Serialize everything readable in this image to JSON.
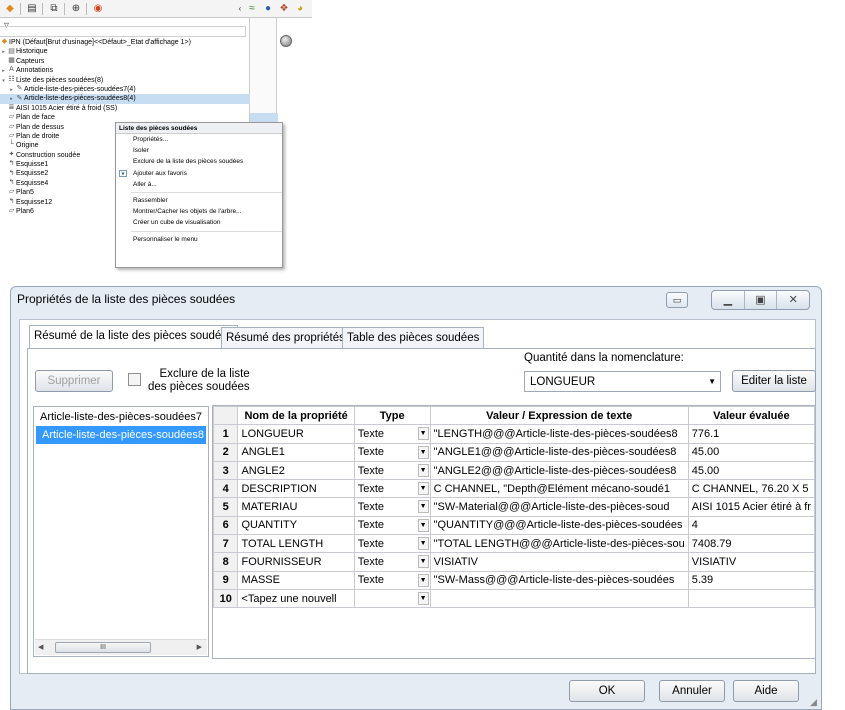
{
  "tree": {
    "root_label": "IPN  (Défaut[Brut d'usinage]<<Défaut>_Etat d'affichage 1>)",
    "items": [
      {
        "label": "Historique",
        "icon": "history-icon",
        "arrow": "▸"
      },
      {
        "label": "Capteurs",
        "icon": "sensor-icon",
        "arrow": ""
      },
      {
        "label": "Annotations",
        "icon": "annotations-icon",
        "arrow": "▸"
      },
      {
        "label": "Liste des pièces soudées(8)",
        "icon": "cutlist-icon",
        "arrow": "▾"
      },
      {
        "label": "Article-liste-des-pièces-soudées7(4)",
        "icon": "cutlist-item-icon",
        "arrow": "▸",
        "indent": 1
      },
      {
        "label": "Article-liste-des-pièces-soudées8(4)",
        "icon": "cutlist-item-icon",
        "arrow": "▸",
        "indent": 1,
        "selected": true
      },
      {
        "label": "AISI 1015 Acier étiré à froid (SS)",
        "icon": "material-icon",
        "arrow": ""
      },
      {
        "label": "Plan de face",
        "icon": "plane-icon",
        "arrow": ""
      },
      {
        "label": "Plan de dessus",
        "icon": "plane-icon",
        "arrow": ""
      },
      {
        "label": "Plan de droite",
        "icon": "plane-icon",
        "arrow": ""
      },
      {
        "label": "Origine",
        "icon": "origin-icon",
        "arrow": ""
      },
      {
        "label": "Construction soudée",
        "icon": "weldment-icon",
        "arrow": ""
      },
      {
        "label": "Esquisse1",
        "icon": "sketch-icon",
        "arrow": ""
      },
      {
        "label": "Esquisse2",
        "icon": "sketch-icon",
        "arrow": ""
      },
      {
        "label": "Esquisse4",
        "icon": "sketch-icon",
        "arrow": ""
      },
      {
        "label": "Plan5",
        "icon": "plane-icon",
        "arrow": ""
      },
      {
        "label": "Esquisse12",
        "icon": "sketch-icon",
        "arrow": ""
      },
      {
        "label": "Plan6",
        "icon": "plane-icon",
        "arrow": ""
      }
    ]
  },
  "context_menu": {
    "header": "Liste des pièces soudées",
    "items": [
      "Propriétés...",
      "Isoler",
      "Exclure de la liste des pièces soudées",
      "Ajouter aux favoris",
      "Aller à...",
      "Rassembler",
      "Montrer/Cacher les objets de l'arbre...",
      "Créer un cube de visualisation",
      "Personnaliser le menu"
    ]
  },
  "dialog": {
    "title": "Propriétés de la liste des pièces soudées",
    "tabs": [
      "Résumé de la liste des pièces soudées",
      "Résumé des propriétés",
      "Table des pièces soudées"
    ],
    "delete_button": "Supprimer",
    "exclude_label_1": "Exclure de la liste",
    "exclude_label_2": "des pièces soudées",
    "quantity_label": "Quantité dans la nomenclature:",
    "quantity_value": "LONGUEUR",
    "edit_list_button": "Editer la liste",
    "cutlist_items": [
      "Article-liste-des-pièces-soudées7",
      "Article-liste-des-pièces-soudées8"
    ],
    "scroll_thumb": "III",
    "columns": [
      "Nom de la propriété",
      "Type",
      "Valeur / Expression de texte",
      "Valeur évaluée"
    ],
    "rows": [
      {
        "n": "1",
        "name": "LONGUEUR",
        "type": "Texte",
        "expr": "\"LENGTH@@@Article-liste-des-pièces-soudées8",
        "value": "776.1"
      },
      {
        "n": "2",
        "name": "ANGLE1",
        "type": "Texte",
        "expr": "\"ANGLE1@@@Article-liste-des-pièces-soudées8",
        "value": "45.00"
      },
      {
        "n": "3",
        "name": "ANGLE2",
        "type": "Texte",
        "expr": "\"ANGLE2@@@Article-liste-des-pièces-soudées8",
        "value": "45.00"
      },
      {
        "n": "4",
        "name": "DESCRIPTION",
        "type": "Texte",
        "expr": "C CHANNEL, \"Depth@Elément mécano-soudé1",
        "value": "C CHANNEL, 76.20 X 5"
      },
      {
        "n": "5",
        "name": "MATERIAU",
        "type": "Texte",
        "expr": "\"SW-Material@@@Article-liste-des-pièces-soud",
        "value": "AISI 1015 Acier étiré à fr"
      },
      {
        "n": "6",
        "name": "QUANTITY",
        "type": "Texte",
        "expr": "\"QUANTITY@@@Article-liste-des-pièces-soudées",
        "value": "4"
      },
      {
        "n": "7",
        "name": "TOTAL LENGTH",
        "type": "Texte",
        "expr": "\"TOTAL LENGTH@@@Article-liste-des-pièces-sou",
        "value": "7408.79"
      },
      {
        "n": "8",
        "name": "FOURNISSEUR",
        "type": "Texte",
        "expr": "VISIATIV",
        "value": "VISIATIV"
      },
      {
        "n": "9",
        "name": "MASSE",
        "type": "Texte",
        "expr": "\"SW-Mass@@@Article-liste-des-pièces-soudées",
        "value": "5.39"
      }
    ],
    "new_row": {
      "n": "10",
      "name": "<Tapez une nouvell"
    },
    "ok_button": "OK",
    "cancel_button": "Annuler",
    "help_button": "Aide"
  }
}
